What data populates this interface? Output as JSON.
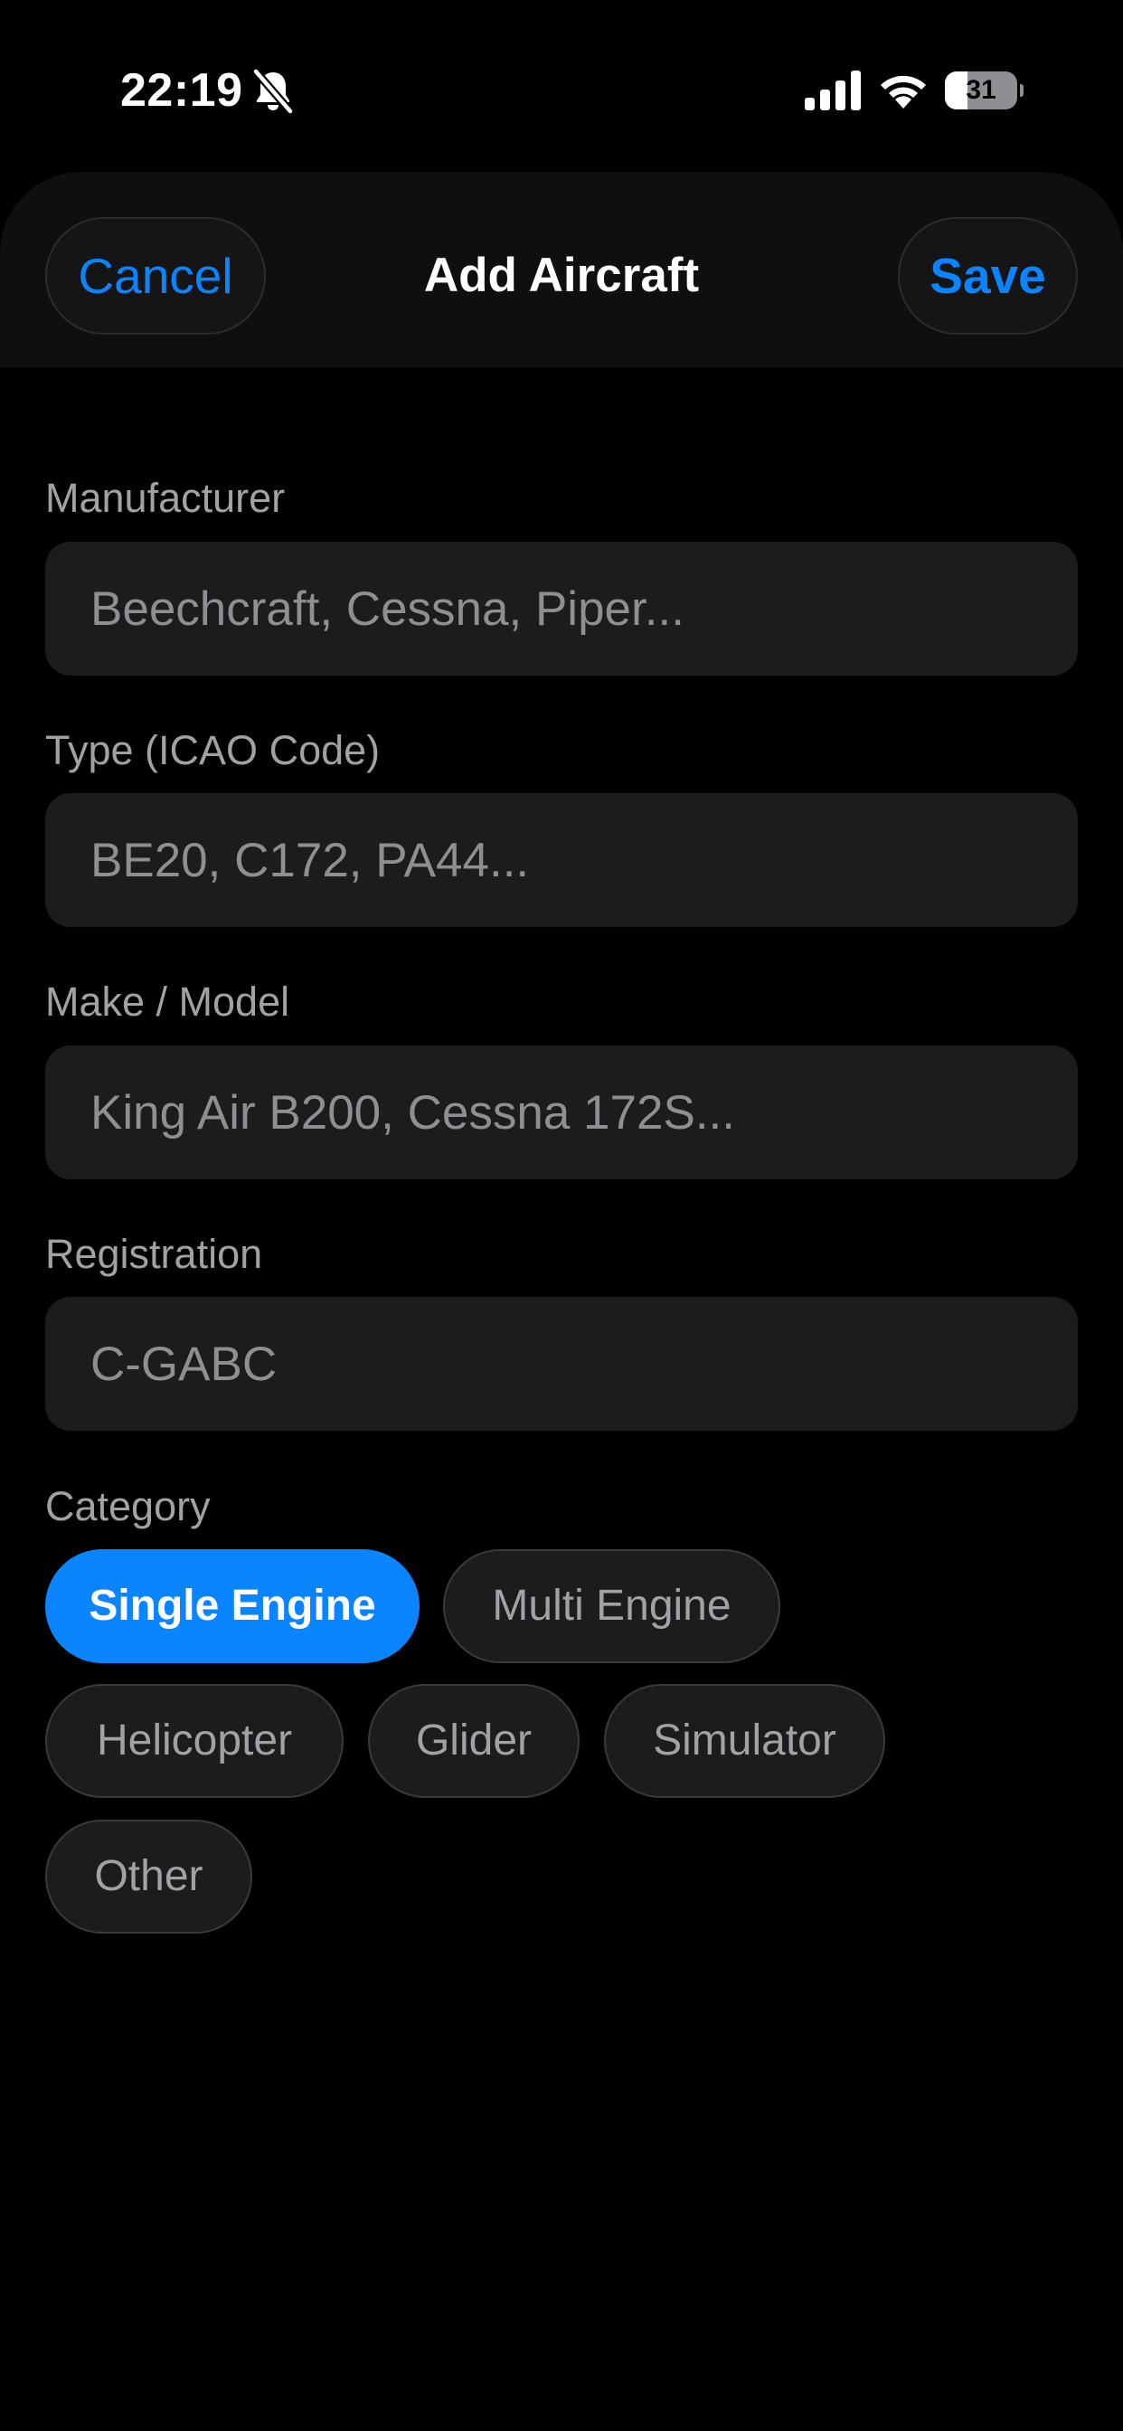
{
  "status_bar": {
    "time": "22:19",
    "battery_level": "31",
    "icons": [
      "bell-slash-icon",
      "cellular-signal-icon",
      "wifi-icon",
      "battery-icon"
    ]
  },
  "header": {
    "cancel_label": "Cancel",
    "title": "Add Aircraft",
    "save_label": "Save"
  },
  "form": {
    "manufacturer": {
      "label": "Manufacturer",
      "value": "",
      "placeholder": "Beechcraft, Cessna, Piper..."
    },
    "type": {
      "label": "Type (ICAO Code)",
      "value": "",
      "placeholder": "BE20, C172, PA44..."
    },
    "make_model": {
      "label": "Make / Model",
      "value": "",
      "placeholder": "King Air B200, Cessna 172S..."
    },
    "registration": {
      "label": "Registration",
      "value": "",
      "placeholder": "C-GABC"
    },
    "category": {
      "label": "Category",
      "selected": "Single Engine",
      "options": [
        "Single Engine",
        "Multi Engine",
        "Helicopter",
        "Glider",
        "Simulator",
        "Other"
      ]
    }
  },
  "colors": {
    "accent": "#0a84ff",
    "background": "#000000",
    "field_background": "#1c1c1e",
    "label": "#a1a1a6"
  }
}
